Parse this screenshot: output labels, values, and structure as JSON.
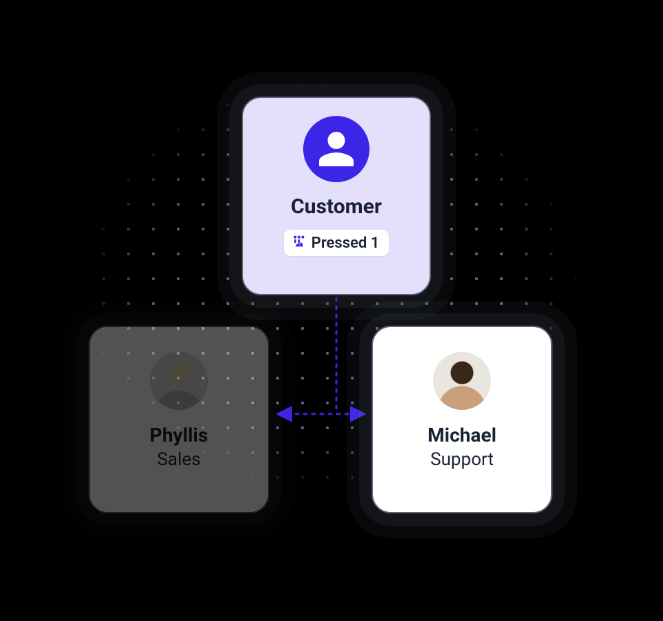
{
  "colors": {
    "accent": "#3b25e6",
    "card_customer_bg": "#e4e0fb",
    "text": "#1a2235",
    "connector": "#3b25e6"
  },
  "customer": {
    "title": "Customer",
    "badge_label": "Pressed 1",
    "badge_icon": "menu-press-icon"
  },
  "agents": [
    {
      "name": "Phyllis",
      "role": "Sales",
      "faded": true
    },
    {
      "name": "Michael",
      "role": "Support",
      "faded": false
    }
  ]
}
